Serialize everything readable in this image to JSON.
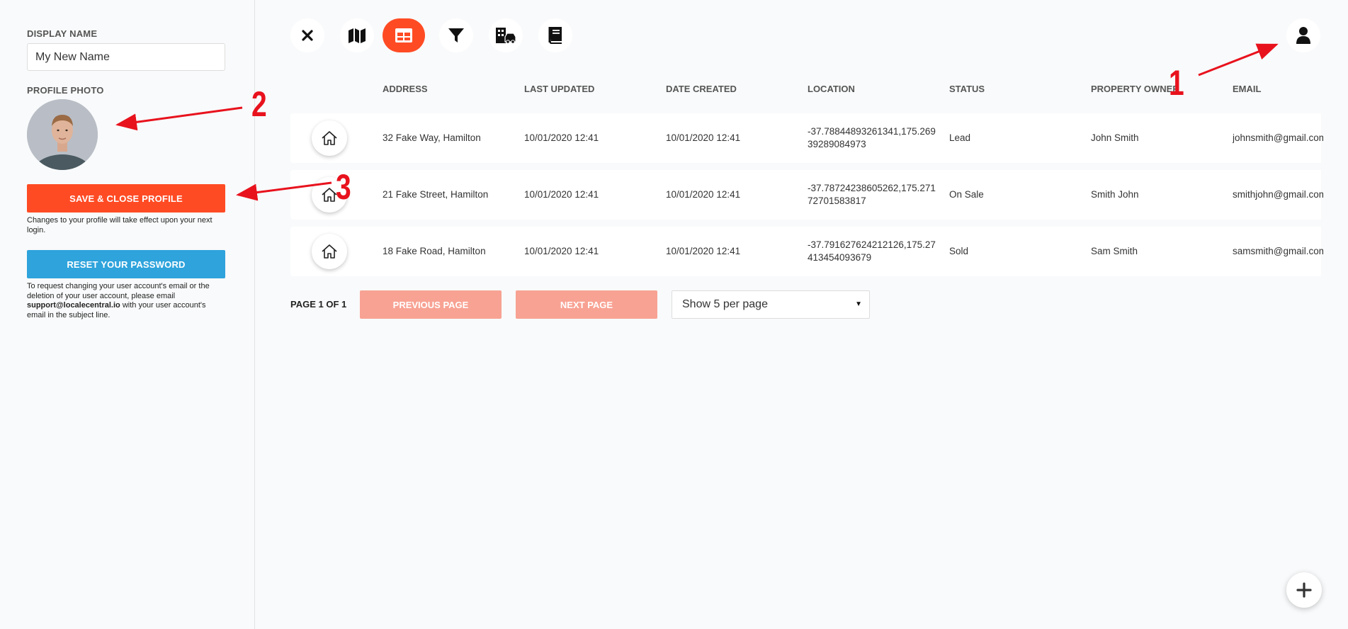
{
  "sidebar": {
    "display_name_label": "DISPLAY NAME",
    "display_name_value": "My New Name",
    "profile_photo_label": "PROFILE PHOTO",
    "save_button": "SAVE & CLOSE PROFILE",
    "save_note": "Changes to your profile will take effect upon your next login.",
    "reset_button": "RESET YOUR PASSWORD",
    "reset_note_pre": "To request changing your user account's email or the deletion of your user account, please email ",
    "reset_note_email": "support@localecentral.io",
    "reset_note_post": " with your user account's email in the subject line."
  },
  "toolbar": {
    "icons": [
      "close-icon",
      "map-icon",
      "table-icon",
      "filter-icon",
      "buildings-car-icon",
      "book-icon"
    ],
    "active_index": 2,
    "accent_color": "#ff4b24"
  },
  "user_button_icon": "user-icon",
  "table": {
    "headers": [
      "ADDRESS",
      "LAST UPDATED",
      "DATE CREATED",
      "LOCATION",
      "STATUS",
      "PROPERTY OWNER",
      "EMAIL"
    ],
    "rows": [
      {
        "address": "32 Fake Way, Hamilton",
        "last_updated": "10/01/2020 12:41",
        "date_created": "10/01/2020 12:41",
        "location": "-37.78844893261341,175.26939289084973",
        "status": "Lead",
        "owner": "John Smith",
        "email": "johnsmith@gmail.com"
      },
      {
        "address": "21 Fake Street, Hamilton",
        "last_updated": "10/01/2020 12:41",
        "date_created": "10/01/2020 12:41",
        "location": "-37.78724238605262,175.27172701583817",
        "status": "On Sale",
        "owner": "Smith John",
        "email": "smithjohn@gmail.com"
      },
      {
        "address": "18 Fake Road, Hamilton",
        "last_updated": "10/01/2020 12:41",
        "date_created": "10/01/2020 12:41",
        "location": "-37.791627624212126,175.27413454093679",
        "status": "Sold",
        "owner": "Sam Smith",
        "email": "samsmith@gmail.com"
      }
    ]
  },
  "pagination": {
    "page_label": "PAGE 1 OF 1",
    "previous": "PREVIOUS PAGE",
    "next": "NEXT PAGE",
    "per_page": "Show 5 per page"
  },
  "annotations": {
    "one": "1",
    "two": "2",
    "three": "3",
    "color": "#e8121d"
  }
}
